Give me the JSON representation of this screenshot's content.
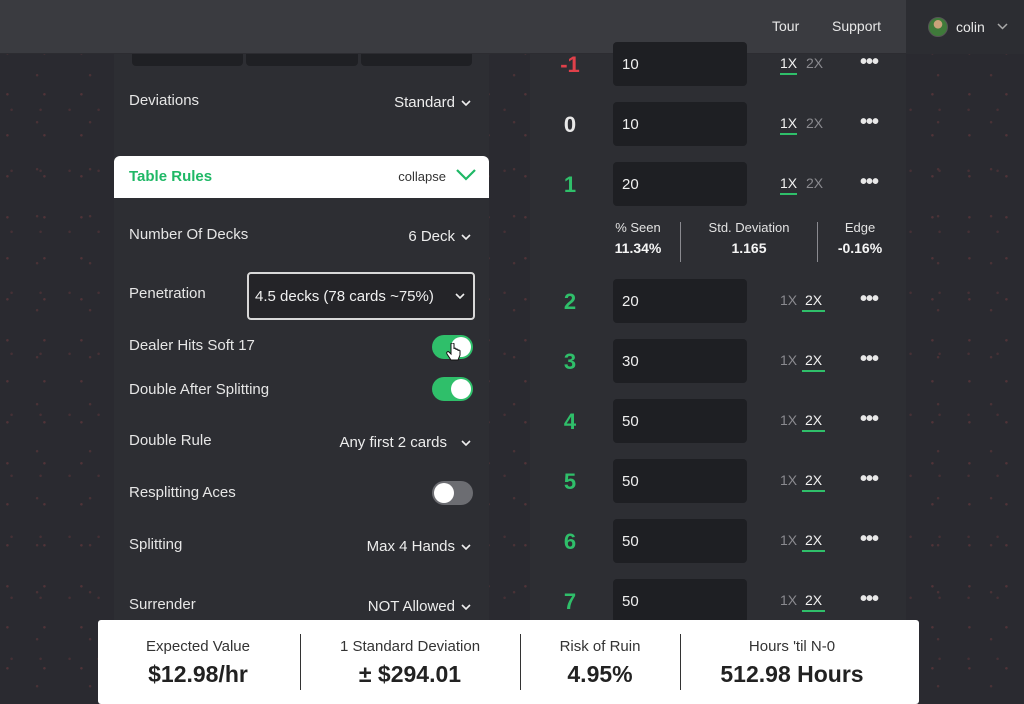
{
  "topbar": {
    "tour": "Tour",
    "support": "Support",
    "user_name": "colin"
  },
  "settings": {
    "deviations": {
      "label": "Deviations",
      "value": "Standard"
    },
    "table_rules": {
      "title": "Table Rules",
      "collapse": "collapse"
    },
    "rows": {
      "decks": {
        "label": "Number Of Decks",
        "value": "6 Deck"
      },
      "penetration": {
        "label": "Penetration",
        "value": "4.5 decks (78 cards ~75%)"
      },
      "dealer_soft17": {
        "label": "Dealer Hits Soft 17",
        "on": true
      },
      "das": {
        "label": "Double After Splitting",
        "on": true
      },
      "double_rule": {
        "label": "Double Rule",
        "value": "Any first 2 cards"
      },
      "resplit_aces": {
        "label": "Resplitting Aces",
        "on": false
      },
      "splitting": {
        "label": "Splitting",
        "value": "Max 4 Hands"
      },
      "surrender": {
        "label": "Surrender",
        "value": "NOT Allowed"
      }
    }
  },
  "bet_spread": [
    {
      "count": "-1",
      "bet": "10",
      "active_mult": "1X"
    },
    {
      "count": "0",
      "bet": "10",
      "active_mult": "1X"
    },
    {
      "count": "1",
      "bet": "20",
      "active_mult": "1X"
    },
    {
      "count": "2",
      "bet": "20",
      "active_mult": "2X"
    },
    {
      "count": "3",
      "bet": "30",
      "active_mult": "2X"
    },
    {
      "count": "4",
      "bet": "50",
      "active_mult": "2X"
    },
    {
      "count": "5",
      "bet": "50",
      "active_mult": "2X"
    },
    {
      "count": "6",
      "bet": "50",
      "active_mult": "2X"
    },
    {
      "count": "7",
      "bet": "50",
      "active_mult": "2X"
    }
  ],
  "mult_labels": {
    "one": "1X",
    "two": "2X"
  },
  "stats": {
    "seen": {
      "label": "% Seen",
      "value": "11.34%"
    },
    "std": {
      "label": "Std. Deviation",
      "value": "1.165"
    },
    "edge": {
      "label": "Edge",
      "value": "-0.16%"
    }
  },
  "summary": {
    "ev": {
      "label": "Expected Value",
      "value": "$12.98/hr"
    },
    "sd": {
      "label": "1 Standard Deviation",
      "value": "± $294.01"
    },
    "ror": {
      "label": "Risk of Ruin",
      "value": "4.95%"
    },
    "n0": {
      "label": "Hours 'til N-0",
      "value": "512.98 Hours"
    }
  },
  "colors": {
    "accent": "#2fbf6a",
    "negative": "#e0404a"
  }
}
